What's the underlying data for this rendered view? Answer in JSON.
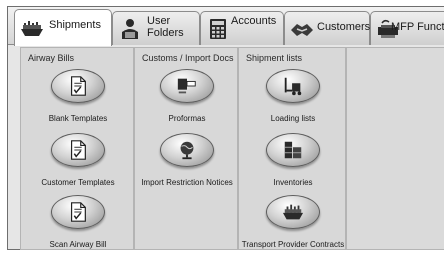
{
  "tabs": [
    {
      "label": "Shipments",
      "icon": "ship-icon",
      "active": true
    },
    {
      "label": "User\nFolders",
      "icon": "user-folder-icon",
      "active": false
    },
    {
      "label": "Accounts",
      "icon": "calculator-icon",
      "active": false
    },
    {
      "label": "Customers",
      "icon": "handshake-icon",
      "active": false
    },
    {
      "label": "MFP Function",
      "icon": "printer-icon",
      "active": false
    }
  ],
  "panels": [
    {
      "title": "Airway Bills",
      "items": [
        {
          "label": "Blank Templates",
          "icon": "document-check-icon"
        },
        {
          "label": "Customer Templates",
          "icon": "document-check-icon"
        },
        {
          "label": "Scan Airway Bill",
          "icon": "document-check-icon"
        }
      ]
    },
    {
      "title": "Customs / Import Docs",
      "items": [
        {
          "label": "Proformas",
          "icon": "stamp-icon"
        },
        {
          "label": "Import Restriction Notices",
          "icon": "globe-icon"
        }
      ]
    },
    {
      "title": "Shipment  lists",
      "items": [
        {
          "label": "Loading lists",
          "icon": "forklift-icon"
        },
        {
          "label": "Inventories",
          "icon": "boxes-icon"
        },
        {
          "label": "Transport Provider Contracts",
          "icon": "ship-icon"
        }
      ]
    }
  ]
}
